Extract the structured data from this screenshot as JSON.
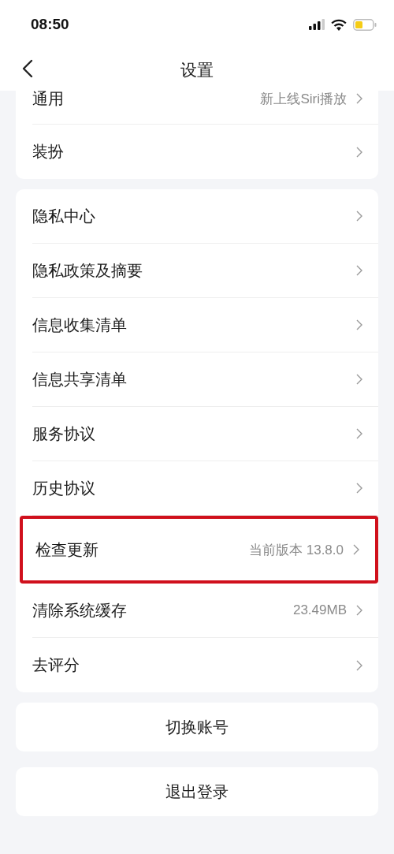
{
  "status_bar": {
    "time": "08:50"
  },
  "nav": {
    "title": "设置"
  },
  "groups": [
    {
      "items": [
        {
          "label": "通用",
          "value": "新上线Siri播放",
          "highlighted": false
        },
        {
          "label": "装扮",
          "highlighted": false
        }
      ]
    },
    {
      "items": [
        {
          "label": "隐私中心",
          "highlighted": false
        },
        {
          "label": "隐私政策及摘要",
          "highlighted": false
        },
        {
          "label": "信息收集清单",
          "highlighted": false
        },
        {
          "label": "信息共享清单",
          "highlighted": false
        },
        {
          "label": "服务协议",
          "highlighted": false
        },
        {
          "label": "历史协议",
          "highlighted": false
        },
        {
          "label": "检查更新",
          "value": "当前版本 13.8.0",
          "highlighted": true
        },
        {
          "label": "清除系统缓存",
          "value": "23.49MB",
          "highlighted": false
        },
        {
          "label": "去评分",
          "highlighted": false
        }
      ]
    }
  ],
  "buttons": [
    "切换账号",
    "退出登录"
  ]
}
